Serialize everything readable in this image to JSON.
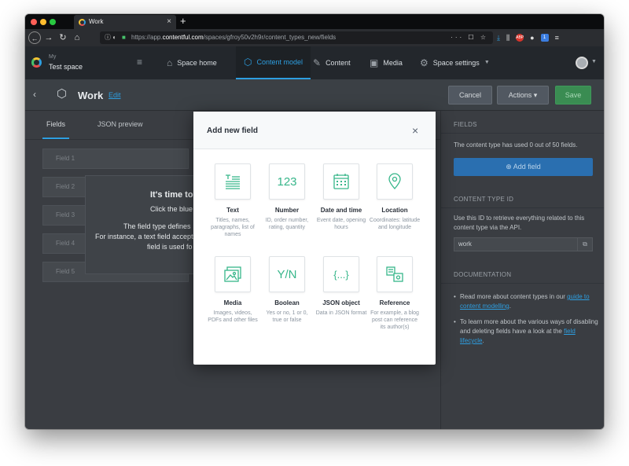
{
  "browser": {
    "tab_title": "Work",
    "tab_close": "×",
    "new_tab": "+",
    "url_host": "https://app.",
    "url_domain": "contentful.com",
    "url_path": "/spaces/gfroy50v2h9r/content_types_new/fields",
    "url_actions": "··· ☐ ☆",
    "toolbar_ext_abp": "ABP",
    "toolbar_ext_badge": "1"
  },
  "appnav": {
    "space_label": "My",
    "space_name": "Test space",
    "items": [
      {
        "label": "Space home",
        "icon": "home-icon"
      },
      {
        "label": "Content model",
        "icon": "content-model-icon"
      },
      {
        "label": "Content",
        "icon": "content-icon"
      },
      {
        "label": "Media",
        "icon": "media-icon"
      },
      {
        "label": "Space settings",
        "icon": "settings-icon"
      }
    ]
  },
  "workbench": {
    "title": "Work",
    "edit_link": "Edit",
    "cancel": "Cancel",
    "actions": "Actions ▾",
    "save": "Save"
  },
  "tabs": [
    "Fields",
    "JSON preview"
  ],
  "ghost_fields": [
    "Field 1",
    "Field 2",
    "Field 3",
    "Field 4",
    "Field 5"
  ],
  "intro": {
    "title": "It's time to",
    "line1": "Click the blue",
    "line2": "The field type defines",
    "line3": "For instance, a text field accept",
    "line4": "field is used fo"
  },
  "sidebar": {
    "fields_heading": "FIELDS",
    "usage": "The content type has used 0 out of 50 fields.",
    "add_field": "Add field",
    "id_heading": "CONTENT TYPE ID",
    "id_text": "Use this ID to retrieve everything related to this content type via the API.",
    "id_value": "work",
    "docs_heading": "DOCUMENTATION",
    "doc1_text": "Read more about content types in our ",
    "doc1_link": "guide to content modelling",
    "doc1_end": ".",
    "doc2_text": "To learn more about the various ways of disabling and deleting fields have a look at the ",
    "doc2_link": "field lifecycle",
    "doc2_end": "."
  },
  "modal": {
    "title": "Add new field",
    "close": "×",
    "field_types": [
      {
        "name": "Text",
        "desc": "Titles, names, paragraphs, list of names",
        "icon": "text-icon"
      },
      {
        "name": "Number",
        "desc": "ID, order number, rating, quantity",
        "icon": "number-icon",
        "glyph": "123"
      },
      {
        "name": "Date and time",
        "desc": "Event date, opening hours",
        "icon": "calendar-icon"
      },
      {
        "name": "Location",
        "desc": "Coordinates: latitude and longitude",
        "icon": "location-pin-icon"
      },
      {
        "name": "Media",
        "desc": "Images, videos, PDFs and other files",
        "icon": "media-image-icon"
      },
      {
        "name": "Boolean",
        "desc": "Yes or no, 1 or 0, true or false",
        "icon": "boolean-icon",
        "glyph": "Y/N"
      },
      {
        "name": "JSON object",
        "desc": "Data in JSON format",
        "icon": "json-icon",
        "glyph": "{...}"
      },
      {
        "name": "Reference",
        "desc": "For example, a blog post can reference its author(s)",
        "icon": "reference-icon"
      }
    ]
  },
  "colors": {
    "accent": "#2d9ee0",
    "field_icon_green": "#37b68a",
    "save_green": "#3a8c52"
  }
}
